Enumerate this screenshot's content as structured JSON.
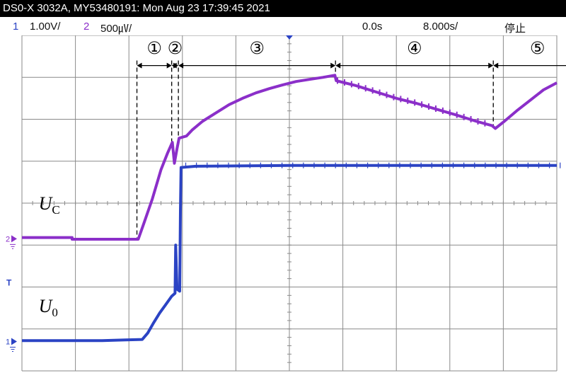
{
  "title_bar": {
    "text": "DS0-X 3032A, MY53480191: Mon Aug 23 17:39:45 2021"
  },
  "status_bar": {
    "ch1_number": "1",
    "ch1_scale": "1.00V/",
    "ch2_number": "2",
    "ch2_scale": "500㎶/",
    "time_delay": "0.0s",
    "time_scale": "8.000s/",
    "run_state": "停止"
  },
  "colors": {
    "ch1": "#2b43c4",
    "ch2": "#8b2fc9",
    "grid": "#8a8a8a",
    "annotation": "#000000",
    "trigger_marker": "#2b43c4"
  },
  "chart_data": {
    "type": "line",
    "x_unit": "s",
    "y_unit": "div",
    "xlim": [
      -40,
      40
    ],
    "ylim": [
      -4,
      4
    ],
    "grid": true,
    "grid_divisions": {
      "x": 10,
      "y": 8
    },
    "channel_markers": [
      {
        "label": "2",
        "level": -0.85,
        "color": "#8b2fc9"
      },
      {
        "label": "1",
        "level": -3.3,
        "color": "#2b43c4"
      }
    ],
    "trigger_marker": {
      "label": "T",
      "level": -1.9
    },
    "series": [
      {
        "name": "U_C",
        "color": "#8b2fc9",
        "points": [
          [
            -40,
            -0.82
          ],
          [
            -32.5,
            -0.82
          ],
          [
            -32.5,
            -0.86
          ],
          [
            -22.6,
            -0.86
          ],
          [
            -21.8,
            -0.5
          ],
          [
            -20.5,
            0.1
          ],
          [
            -19.2,
            0.8
          ],
          [
            -18.2,
            1.2
          ],
          [
            -17.5,
            1.45
          ],
          [
            -17.2,
            0.95
          ],
          [
            -16.8,
            1.3
          ],
          [
            -16.5,
            1.55
          ],
          [
            -15.4,
            1.6
          ],
          [
            -14.5,
            1.75
          ],
          [
            -13,
            1.95
          ],
          [
            -11,
            2.15
          ],
          [
            -9,
            2.35
          ],
          [
            -7,
            2.5
          ],
          [
            -5,
            2.63
          ],
          [
            -3,
            2.73
          ],
          [
            -1,
            2.82
          ],
          [
            1,
            2.9
          ],
          [
            3,
            2.95
          ],
          [
            5,
            3.0
          ],
          [
            6.8,
            3.05
          ],
          [
            7.0,
            2.92
          ],
          [
            10,
            2.8
          ],
          [
            13,
            2.65
          ],
          [
            16,
            2.5
          ],
          [
            19,
            2.38
          ],
          [
            22,
            2.24
          ],
          [
            25,
            2.1
          ],
          [
            28,
            1.95
          ],
          [
            30.3,
            1.85
          ],
          [
            30.8,
            1.78
          ],
          [
            32,
            1.93
          ],
          [
            34,
            2.2
          ],
          [
            36,
            2.45
          ],
          [
            38,
            2.7
          ],
          [
            40,
            2.87
          ],
          [
            42,
            2.98
          ],
          [
            43.7,
            3.05
          ],
          [
            44,
            2.95
          ],
          [
            46,
            2.85
          ],
          [
            48,
            2.75
          ],
          [
            50,
            2.62
          ],
          [
            50.8,
            2.55
          ]
        ]
      },
      {
        "name": "U_0",
        "color": "#2b43c4",
        "points": [
          [
            -40,
            -3.28
          ],
          [
            -28,
            -3.28
          ],
          [
            -24.5,
            -3.26
          ],
          [
            -22,
            -3.25
          ],
          [
            -21.2,
            -3.1
          ],
          [
            -20.3,
            -2.85
          ],
          [
            -19.4,
            -2.62
          ],
          [
            -18.5,
            -2.42
          ],
          [
            -17.6,
            -2.22
          ],
          [
            -17.1,
            -2.15
          ],
          [
            -17.0,
            -1.0
          ],
          [
            -16.8,
            -2.05
          ],
          [
            -16.4,
            -2.1
          ],
          [
            -16.3,
            -0.2
          ],
          [
            -16.2,
            0.85
          ],
          [
            -14,
            0.88
          ],
          [
            0,
            0.9
          ],
          [
            20,
            0.9
          ],
          [
            40,
            0.9
          ],
          [
            50.8,
            0.9
          ]
        ]
      }
    ],
    "axis_labels": [
      {
        "name": "U_C",
        "italic": "U",
        "sub": "C",
        "x": -37.5,
        "y": -0.15
      },
      {
        "name": "U_0",
        "italic": "U",
        "sub": "0",
        "x": -37.5,
        "y": -2.6
      }
    ],
    "vertical_markers": [
      {
        "x": -22.8,
        "y_top": 3.4,
        "y_bottom": -0.86
      },
      {
        "x": -17.6,
        "y_top": 3.4,
        "y_bottom": 1.4
      },
      {
        "x": -16.6,
        "y_top": 3.4,
        "y_bottom": 1.5
      },
      {
        "x": 6.9,
        "y_top": 3.4,
        "y_bottom": 3.05
      },
      {
        "x": 30.5,
        "y_top": 3.4,
        "y_bottom": 1.85
      },
      {
        "x": 43.7,
        "y_top": 3.4,
        "y_bottom": 3.05
      }
    ],
    "phase_arrows": [
      {
        "label": "①",
        "from": -22.8,
        "to": -17.6,
        "y": 3.28
      },
      {
        "label": "②",
        "from": -17.6,
        "to": -16.6,
        "y": 3.28
      },
      {
        "label": "③",
        "from": -16.6,
        "to": 6.9,
        "y": 3.28
      },
      {
        "label": "④",
        "from": 6.9,
        "to": 30.5,
        "y": 3.28
      },
      {
        "label": "⑤",
        "from": 30.5,
        "to": 43.7,
        "y": 3.28
      }
    ],
    "phase_label_y": 3.7
  }
}
